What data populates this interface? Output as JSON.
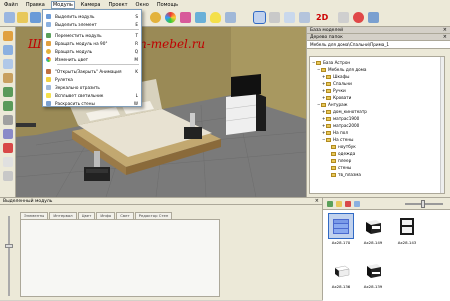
{
  "menubar": {
    "items": [
      {
        "label": "Файл"
      },
      {
        "label": "Правка"
      },
      {
        "label": "Модуль"
      },
      {
        "label": "Камера"
      },
      {
        "label": "Проект"
      },
      {
        "label": "Окно"
      },
      {
        "label": "Помощь"
      }
    ],
    "active_index": 2
  },
  "module_menu": {
    "items": [
      {
        "label": "Выделить модуль",
        "shortcut": "S",
        "icon": "select-module-icon"
      },
      {
        "label": "Выделить элемент",
        "shortcut": "E",
        "icon": "select-element-icon"
      },
      {
        "label": "Переместить модуль",
        "shortcut": "T",
        "icon": "move-module-icon"
      },
      {
        "label": "Вращать модуль на 90°",
        "shortcut": "R",
        "icon": "rotate-90-icon"
      },
      {
        "label": "Вращать модуль",
        "shortcut": "Q",
        "icon": "rotate-module-icon"
      },
      {
        "label": "Изменить цвет",
        "shortcut": "M",
        "icon": "change-color-icon"
      },
      {
        "label": "\"Открыть/Закрыть\" Анимация",
        "shortcut": "K",
        "icon": "animation-icon"
      },
      {
        "label": "Рулетка",
        "shortcut": "",
        "icon": "tape-measure-icon"
      },
      {
        "label": "Зеркально отразить",
        "shortcut": "",
        "icon": "mirror-icon"
      },
      {
        "label": "Всплывет светильник",
        "shortcut": "L",
        "icon": "lamp-icon"
      },
      {
        "label": "Раскрасить стены",
        "shortcut": "W",
        "icon": "paint-walls-icon"
      }
    ]
  },
  "viewport": {
    "watermark": "Школа www.astron-mebel.ru"
  },
  "model_base_panel": {
    "title": "База моделей",
    "tree_title": "Дерево папок",
    "breadcrumb": "Мебель для дома\\Спальни\\Прима_1",
    "tree": [
      {
        "label": "База Астрон",
        "level": 0,
        "expanded": true
      },
      {
        "label": "Мебель для дома",
        "level": 1,
        "expanded": true
      },
      {
        "label": "Шкафы",
        "level": 2,
        "expanded": false
      },
      {
        "label": "Спальни",
        "level": 2,
        "expanded": false
      },
      {
        "label": "Ручки",
        "level": 2,
        "expanded": false
      },
      {
        "label": "Кровати",
        "level": 2,
        "expanded": false
      },
      {
        "label": "Антураж",
        "level": 1,
        "expanded": true
      },
      {
        "label": "дом_кинотеатр",
        "level": 2,
        "expanded": false
      },
      {
        "label": "матрас1900",
        "level": 2,
        "expanded": false
      },
      {
        "label": "матрас2000",
        "level": 2,
        "expanded": false
      },
      {
        "label": "На пол",
        "level": 2,
        "expanded": false
      },
      {
        "label": "На стены",
        "level": 2,
        "expanded": true
      },
      {
        "label": "ноутбук",
        "level": 3,
        "expanded": false
      },
      {
        "label": "одежда",
        "level": 3,
        "expanded": false
      },
      {
        "label": "плеер",
        "level": 3,
        "expanded": false
      },
      {
        "label": "стены",
        "level": 3,
        "expanded": false
      },
      {
        "label": "тв_плазма",
        "level": 3,
        "expanded": false
      }
    ]
  },
  "selected_module_panel": {
    "title": "Выделенный модуль",
    "tabs": [
      {
        "label": "Элементы"
      },
      {
        "label": "Интервал"
      },
      {
        "label": "Цвет"
      },
      {
        "label": "Инфо"
      },
      {
        "label": "Свет"
      },
      {
        "label": "Редактор Стен"
      }
    ]
  },
  "browser": {
    "thumbs": [
      {
        "caption": "Ax28.170",
        "selected": true,
        "kind": "dresser"
      },
      {
        "caption": "Ax28.149",
        "selected": false,
        "kind": "nightstand-white"
      },
      {
        "caption": "Ax28.143",
        "selected": false,
        "kind": "wardrobe"
      },
      {
        "caption": "Ax28.136",
        "selected": false,
        "kind": "nightstand-white-small"
      },
      {
        "caption": "Ax28.139",
        "selected": false,
        "kind": "nightstand-dark"
      }
    ]
  },
  "colors": {
    "accent": "#316ac5",
    "watermark": "#c00000",
    "wall": "#9a8a56",
    "floor": "#7a7a7a"
  }
}
